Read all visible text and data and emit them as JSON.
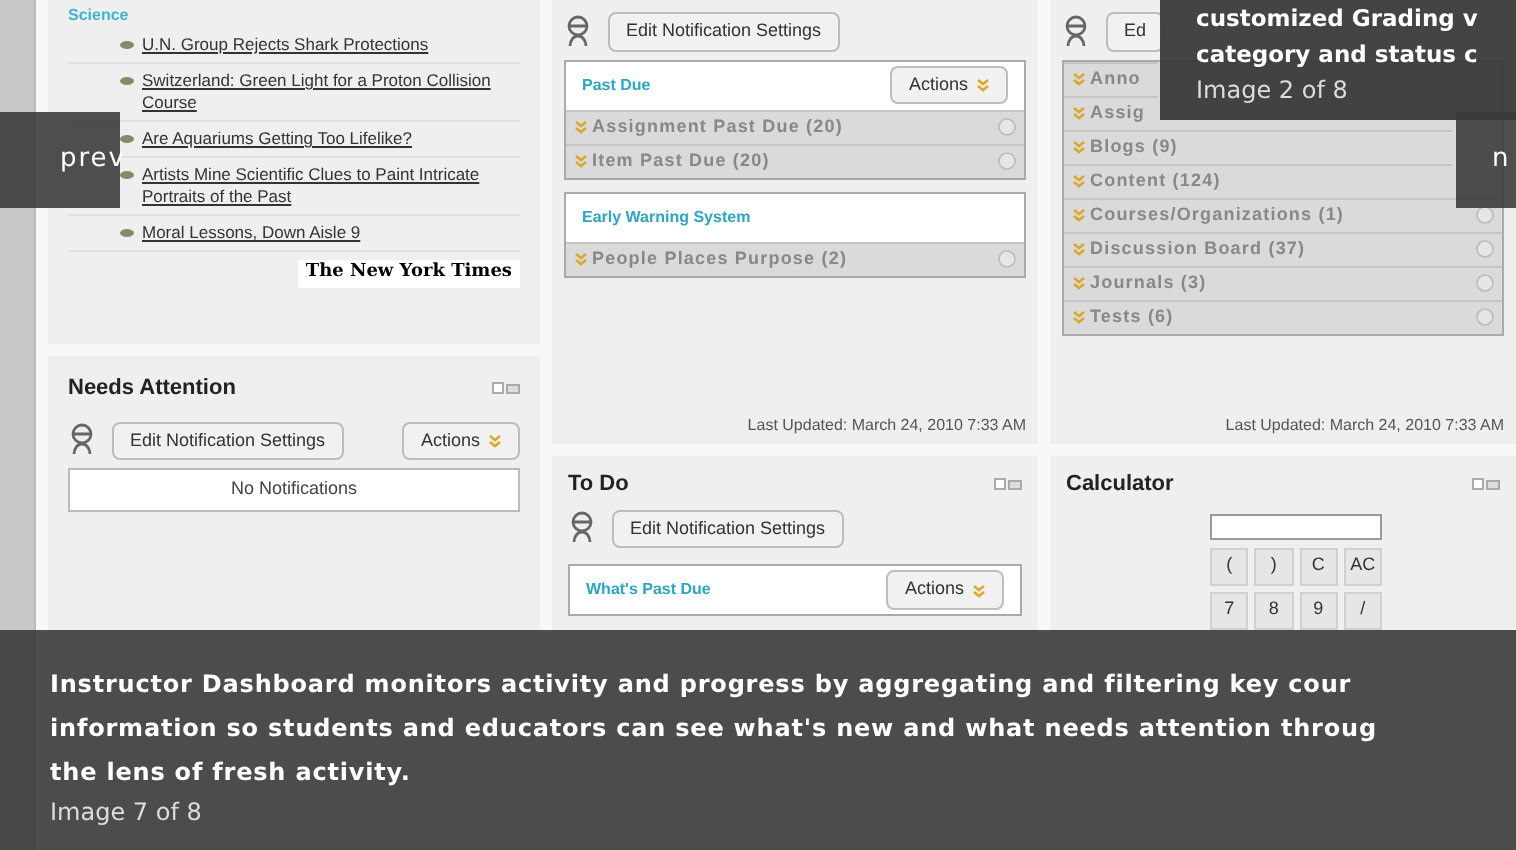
{
  "news": {
    "category": "Science",
    "headlines": [
      "U.N. Group Rejects Shark Protections",
      "Switzerland: Green Light for a Proton Collision Course",
      "Are Aquariums Getting Too Lifelike?",
      "Artists Mine Scientific Clues to Paint Intricate Portraits of the Past",
      "Moral Lessons, Down Aisle 9"
    ],
    "source": "The New York Times"
  },
  "needs_attention": {
    "title": "Needs Attention",
    "edit_button": "Edit Notification Settings",
    "actions_button": "Actions",
    "empty_message": "No Notifications"
  },
  "alerts": {
    "edit_button": "Edit Notification Settings",
    "groups": [
      {
        "title": "Past Due",
        "actions_button": "Actions",
        "items": [
          "Assignment Past Due (20)",
          "Item Past Due (20)"
        ]
      },
      {
        "title": "Early Warning System",
        "items": [
          "People Places Purpose (2)"
        ]
      }
    ],
    "last_updated": "Last Updated: March 24, 2010 7:33 AM"
  },
  "todo": {
    "title": "To Do",
    "edit_button": "Edit Notification Settings",
    "section": "What's Past Due",
    "actions_button": "Actions"
  },
  "whats_new": {
    "edit_button": "Ed",
    "items": [
      "Anno",
      "Assig",
      "Blogs (9)",
      "Content (124)",
      "Courses/Organizations (1)",
      "Discussion Board (37)",
      "Journals (3)",
      "Tests (6)"
    ],
    "last_updated": "Last Updated: March 24, 2010 7:33 AM"
  },
  "calculator": {
    "title": "Calculator",
    "keys": [
      "(",
      ")",
      "C",
      "AC",
      "7",
      "8",
      "9",
      "/"
    ]
  },
  "prev_button": "prev",
  "next_button": "n",
  "top_caption": {
    "lines": [
      "customized Grading v",
      "category and status c"
    ],
    "counter": "Image 2 of 8"
  },
  "caption": {
    "lines": [
      "Instructor Dashboard monitors activity and progress by aggregating and filtering key cour",
      "information so students and educators can see what's new and what needs attention throug",
      "the lens of fresh activity."
    ],
    "counter": "Image 7 of 8"
  }
}
